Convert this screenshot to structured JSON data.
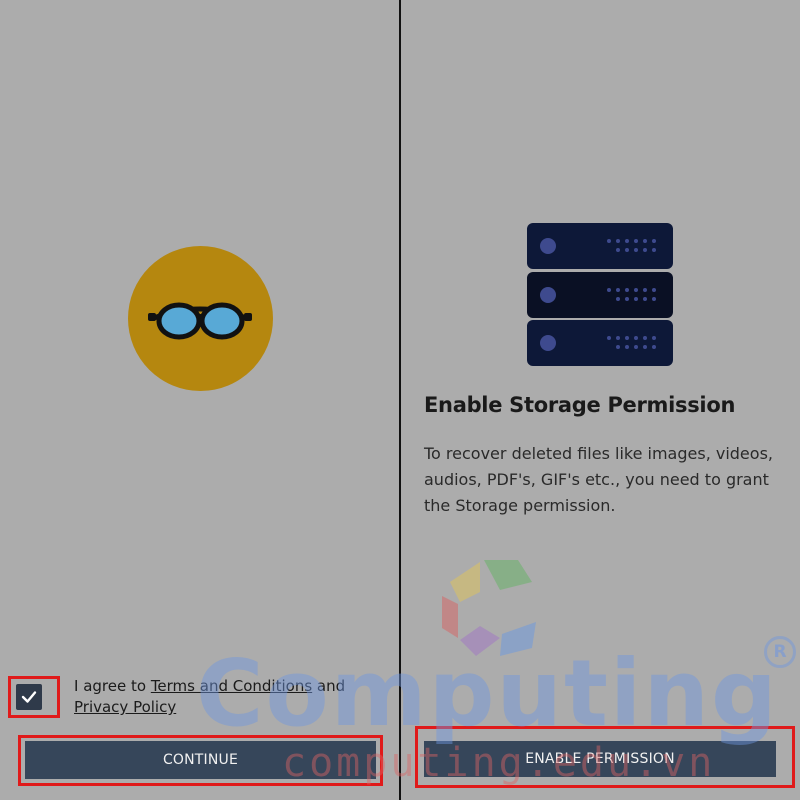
{
  "left_screen": {
    "logo_icon": "sunglasses-icon",
    "agree": {
      "checked": true,
      "prefix": "I agree to",
      "terms_link": "Terms and Conditions",
      "connector": "and",
      "privacy_link": "Privacy Policy"
    },
    "continue_label": "CONTINUE"
  },
  "right_screen": {
    "icon": "server-storage-icon",
    "title": "Enable Storage Permission",
    "description": "To recover deleted files like images, videos, audios, PDF's, GIF's etc., you need to grant the Storage permission.",
    "enable_label": "ENABLE PERMISSION"
  },
  "watermark": {
    "word": "Computing",
    "url": "computing.edu.vn",
    "registered": "R"
  },
  "colors": {
    "background": "#acacac",
    "logo_circle": "#b5870f",
    "button": "#36465a",
    "highlight": "#e01a1a"
  }
}
